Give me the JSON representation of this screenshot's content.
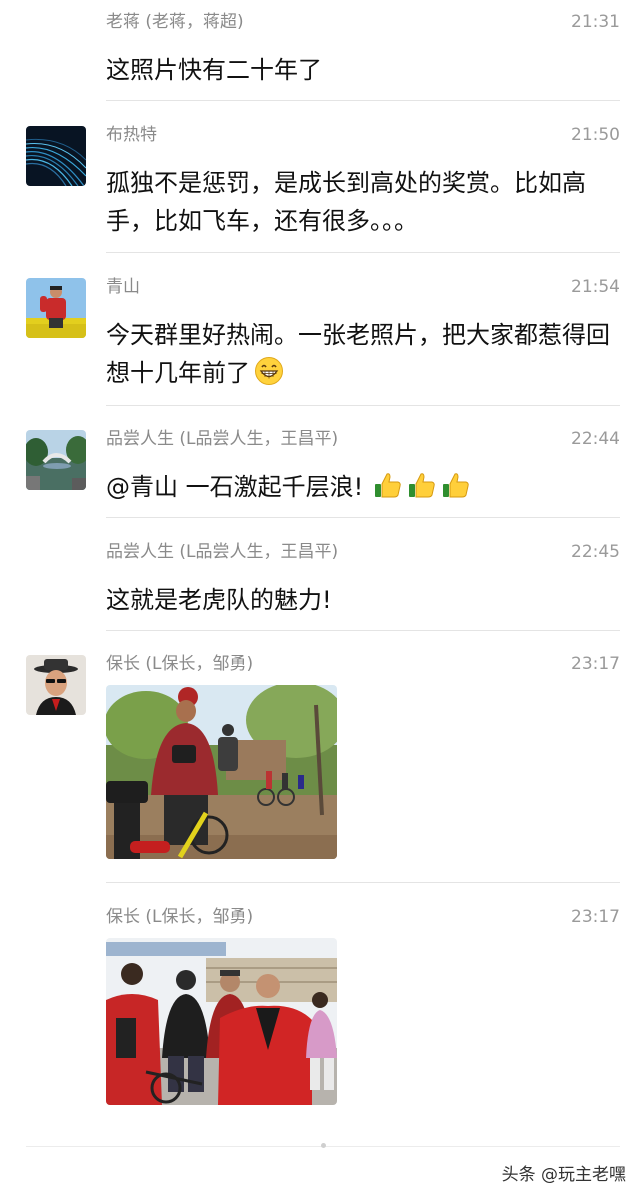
{
  "messages": [
    {
      "sender": "老蒋 (老蒋，蒋超)",
      "time": "21:31",
      "text": "这照片快有二十年了"
    },
    {
      "sender": "布热特",
      "time": "21:50",
      "text": "孤独不是惩罚，是成长到高处的奖赏。比如高手，比如飞车，还有很多。。。"
    },
    {
      "sender": "青山",
      "time": "21:54",
      "text": "今天群里好热闹。一张老照片，把大家都惹得回想十几年前了",
      "emoji": "grinning-face-emoji"
    },
    {
      "sender": "品尝人生 (L品尝人生，王昌平)",
      "time": "22:44",
      "text": "@青山 一石激起千层浪!",
      "emoji": "thumbs-up-emoji x3"
    },
    {
      "sender": "品尝人生 (L品尝人生，王昌平)",
      "time": "22:45",
      "text": "这就是老虎队的魅力!"
    },
    {
      "sender": "保长 (L保长，邹勇)",
      "time": "23:17",
      "image": "cyclists-photo"
    },
    {
      "sender": "保长 (L保长，邹勇)",
      "time": "23:17",
      "image": "group-photo"
    }
  ],
  "watermark": "头条 @玩主老嘿",
  "colors": {
    "sender": "#8a8a8a",
    "time": "#9a9a9a",
    "text": "#111111",
    "divider": "#e4e4e4"
  }
}
